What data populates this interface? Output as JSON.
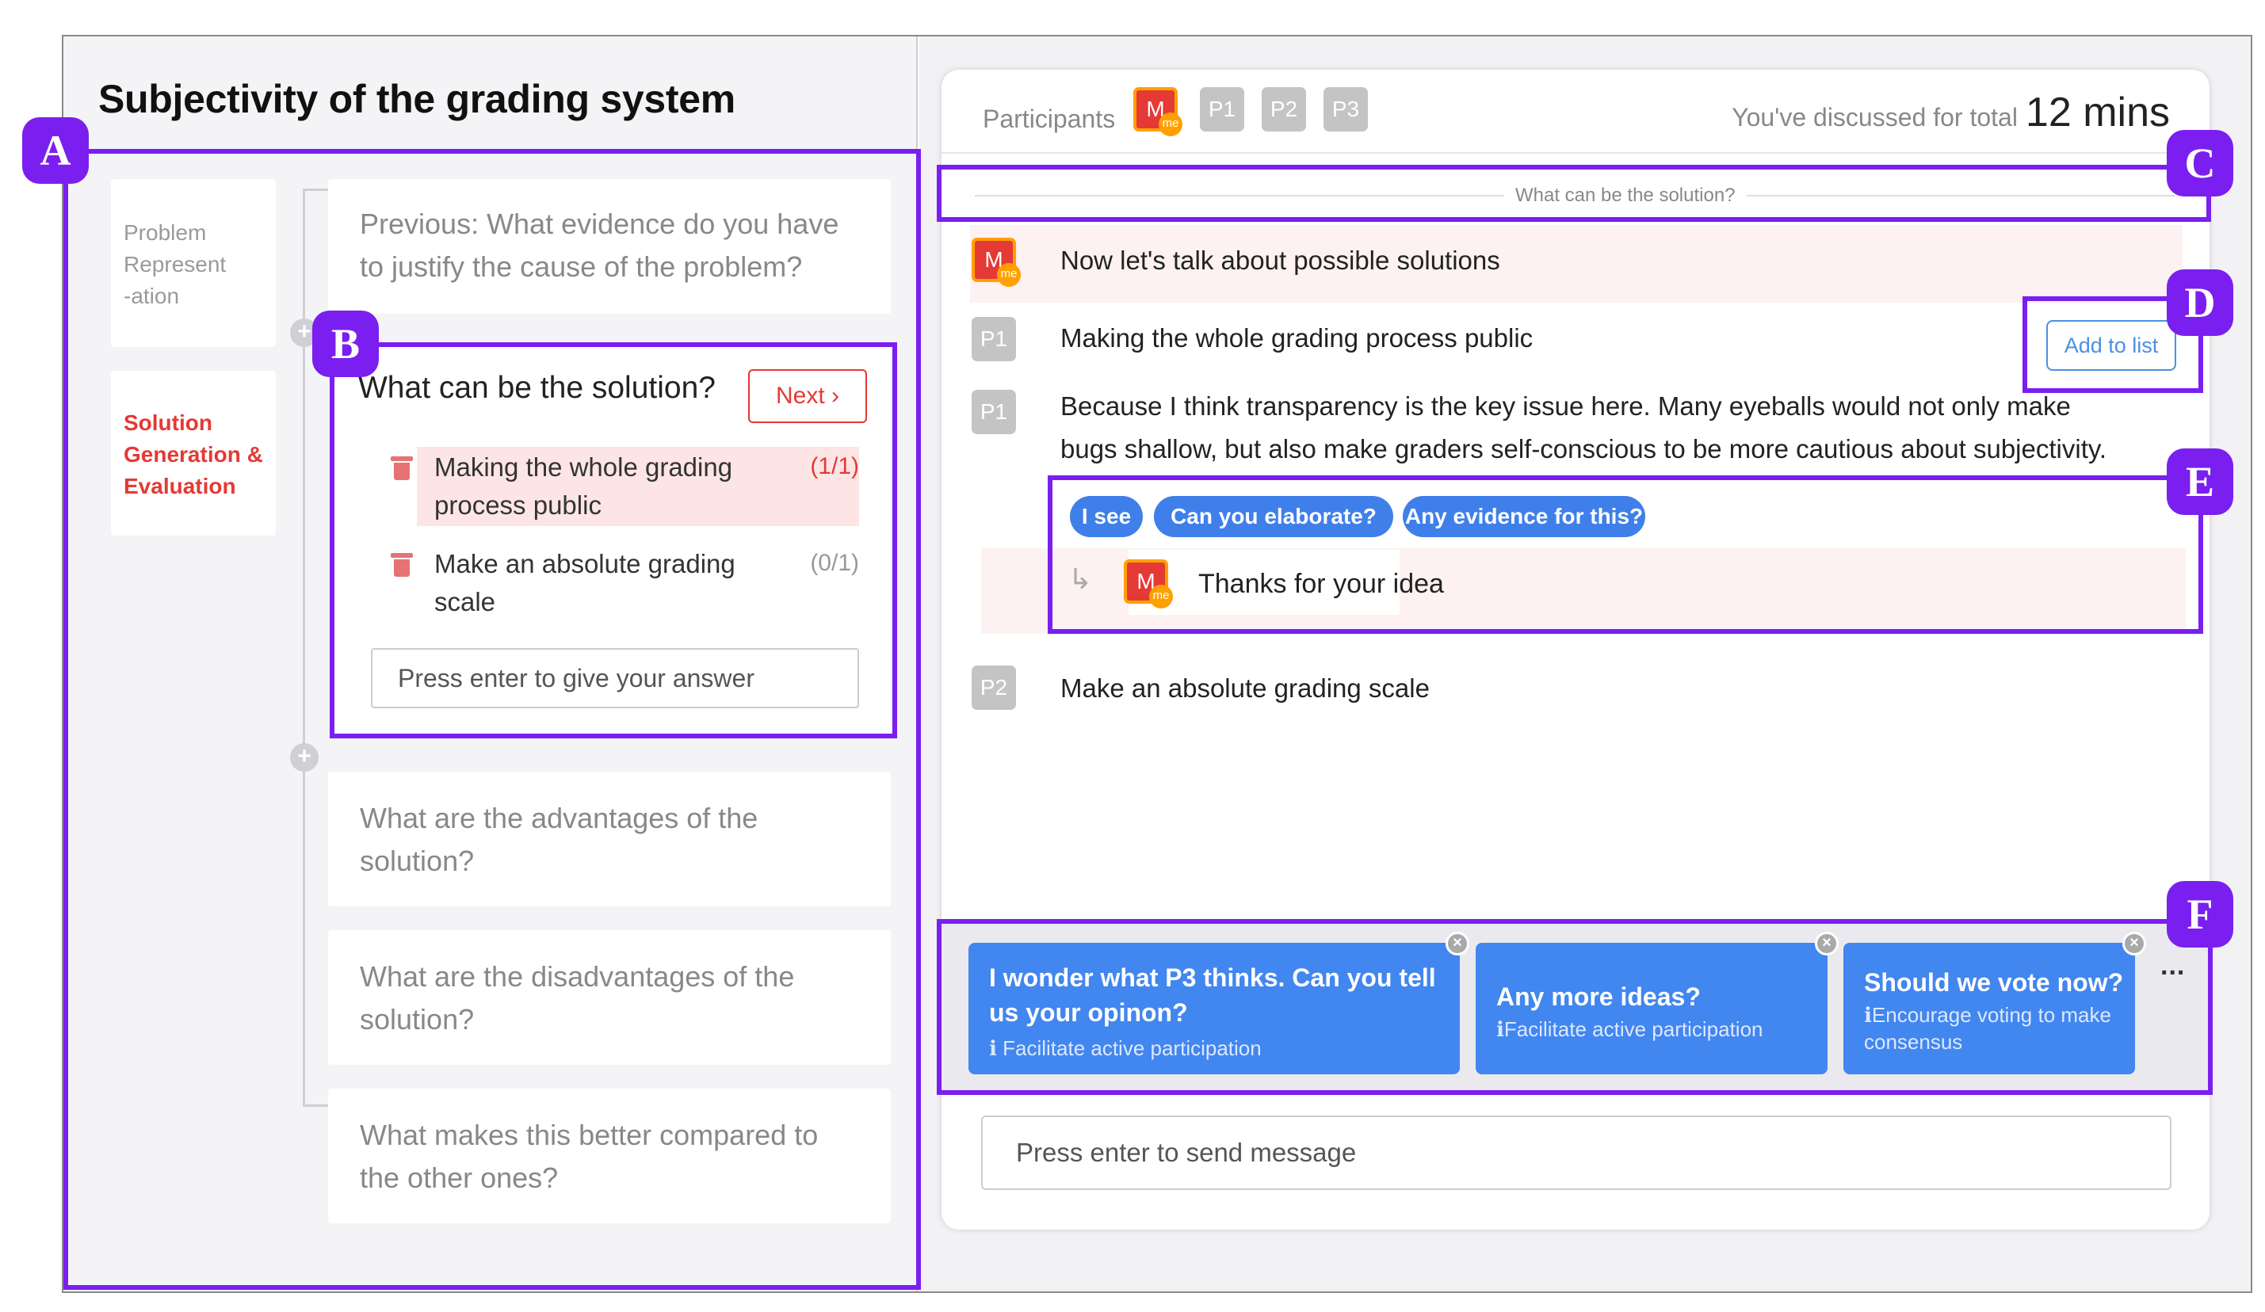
{
  "topic": {
    "title": "Subjectivity of the grading system"
  },
  "stages": [
    {
      "label": "Problem Represent -ation",
      "lines": [
        "Problem",
        "Represent",
        "-ation"
      ],
      "active": false
    },
    {
      "label": "Solution Generation & Evaluation",
      "lines": [
        "Solution",
        "Generation &",
        "Evaluation"
      ],
      "active": true
    }
  ],
  "questions": {
    "previous": [
      "Previous: What evidence do you have",
      "to justify the cause of the problem?"
    ],
    "active": {
      "title": "What can be the solution?",
      "next_label": "Next",
      "answers": [
        {
          "lines": [
            "Making the whole grading",
            "process public"
          ],
          "count": "(1/1)",
          "highlighted": true
        },
        {
          "lines": [
            "Make an absolute grading",
            "scale"
          ],
          "count": "(0/1)",
          "highlighted": false
        }
      ],
      "answer_placeholder": "Press enter to give your answer"
    },
    "upcoming": [
      [
        "What are the advantages of the",
        "solution?"
      ],
      [
        "What are the disadvantages of the",
        "solution?"
      ],
      [
        "What makes this better compared to",
        "the other ones?"
      ]
    ]
  },
  "chat": {
    "participants_label": "Participants",
    "participants": [
      {
        "label": "M",
        "badge": "me",
        "is_me": true
      },
      {
        "label": "P1",
        "is_me": false
      },
      {
        "label": "P2",
        "is_me": false
      },
      {
        "label": "P3",
        "is_me": false
      }
    ],
    "discussed_prefix": "You've discussed for total",
    "discussed_time": "12 mins",
    "section_label": "What can be the solution?",
    "messages": [
      {
        "author": "M",
        "badge": "me",
        "text": "Now let's talk about possible solutions"
      },
      {
        "author": "P1",
        "text": "Making the whole grading process public",
        "action": "Add to list"
      },
      {
        "author": "P1",
        "lines": [
          "Because I think transparency is the key issue here. Many eyeballs would not only make",
          "bugs shallow, but also make graders self-conscious to be more cautious about subjectivity."
        ]
      },
      {
        "author": "P2",
        "text": "Make an absolute grading scale"
      }
    ],
    "quick_replies": [
      "I see",
      "Can you elaborate?",
      "Any evidence for this?"
    ],
    "reply": {
      "author": "M",
      "badge": "me",
      "text": "Thanks for your idea",
      "arrow": "↳"
    },
    "suggestions": [
      {
        "lines": [
          "I wonder what P3 thinks. Can you tell",
          "us your opinon?"
        ],
        "hint": "Facilitate active participation"
      },
      {
        "lines": [
          "Any more ideas?"
        ],
        "hint": "Facilitate active participation"
      },
      {
        "lines": [
          "Should we vote now?"
        ],
        "hint_lines": [
          "Encourage voting to make",
          "consensus"
        ]
      }
    ],
    "more_label": "...",
    "send_placeholder": "Press enter to send message"
  },
  "annotations": [
    "A",
    "B",
    "C",
    "D",
    "E",
    "F"
  ],
  "colors": {
    "accent_red": "#e53935",
    "me_orange": "#ffa000",
    "chip_blue": "#3f7fea",
    "card_blue": "#4286ef",
    "annotation_purple": "#7a1ff0"
  }
}
